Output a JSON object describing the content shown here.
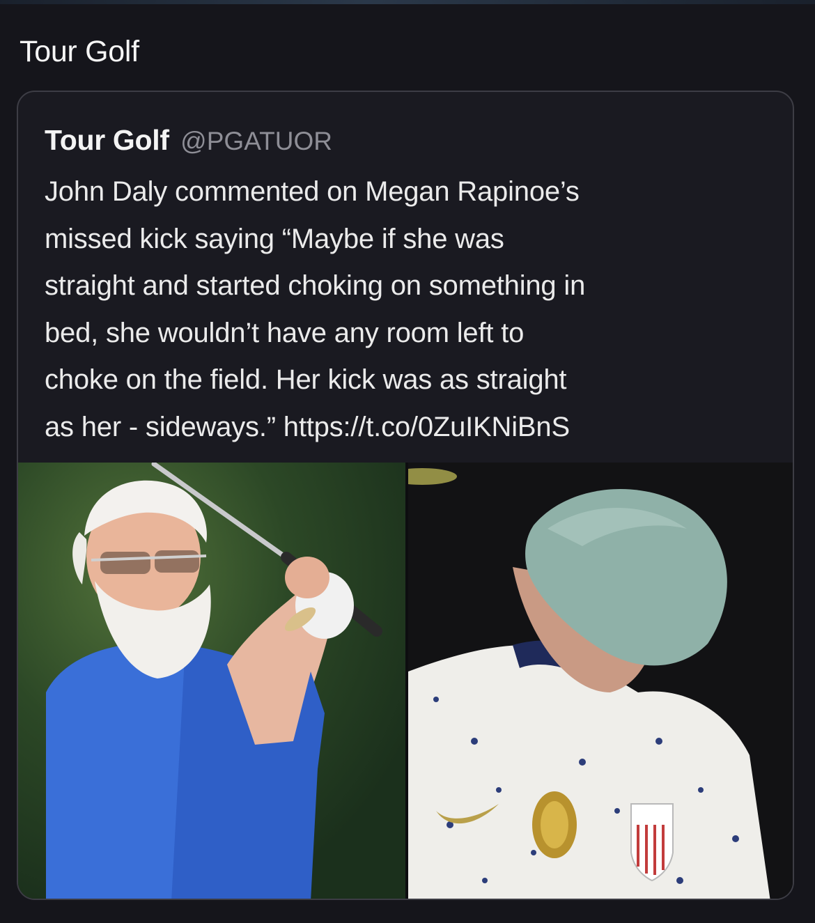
{
  "header": {
    "title": "Tour Golf"
  },
  "quoted_tweet": {
    "author_name": "Tour Golf",
    "author_handle": "@PGATUOR",
    "text_lines": [
      "John Daly commented on Megan Rapinoe’s",
      "missed kick saying “Maybe if she was",
      "straight and started choking on something in",
      "bed, she wouldn’t have any room left to",
      "choke on the field. Her kick was as straight",
      "as her - sideways.” https://t.co/0ZuIKNiBnS"
    ],
    "images": [
      {
        "subject": "golfer-swinging"
      },
      {
        "subject": "soccer-player-head-down"
      }
    ]
  },
  "colors": {
    "background": "#15151b",
    "card_border": "#3d3d45",
    "text_primary": "#f2f2f2",
    "text_secondary": "#8e8e96"
  }
}
